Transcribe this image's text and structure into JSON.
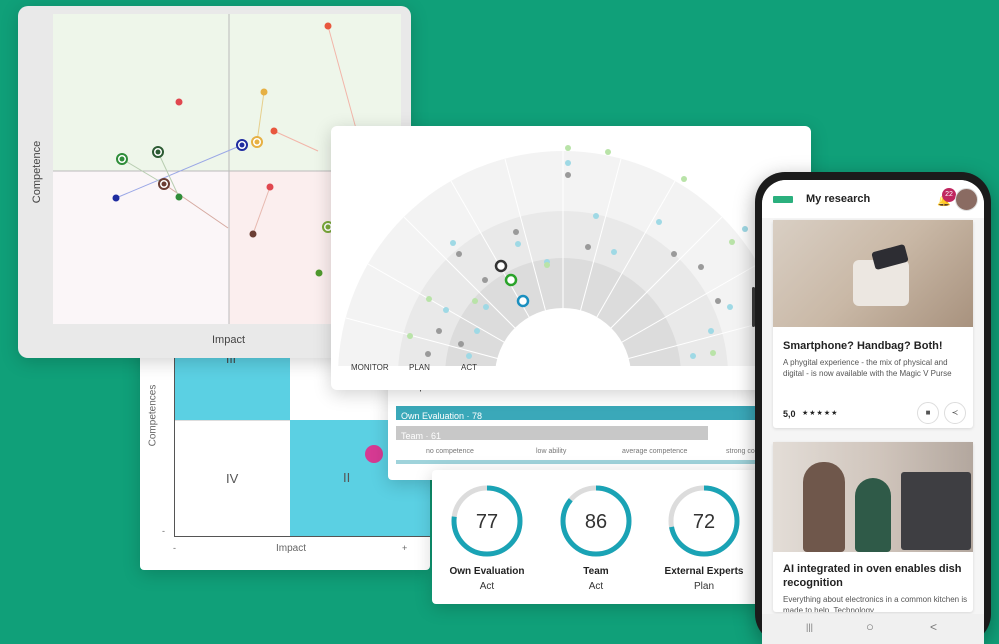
{
  "colors": {
    "background": "#10a079",
    "teal": "#1aa3b5",
    "quadrant_blue": "#5bd0e3",
    "magenta": "#d63a93",
    "gauge_track": "#dcdcdc",
    "own_eval_bar": "#3aa8b9",
    "team_bar": "#c8c8c8"
  },
  "scatter_card": {
    "y_axis_label": "Competence",
    "x_axis_label": "Impact"
  },
  "matrix_card": {
    "y_axis_label": "Competences",
    "x_axis_label": "Impact",
    "quadrants": {
      "top_left": "III",
      "bottom_left": "IV",
      "bottom_right": "II"
    },
    "x_min": "-",
    "x_max": "+",
    "y_min": "-"
  },
  "radar_card": {
    "rings": [
      "MONITOR",
      "PLAN",
      "ACT"
    ]
  },
  "bars_card": {
    "title": "Competences",
    "own_eval_label": "Own Evaluation · 78",
    "team_label": "Team · 61",
    "own_eval_value": 78,
    "team_value": 61,
    "scale": [
      "no competence",
      "low ability",
      "average competence",
      "strong co"
    ]
  },
  "gauges": [
    {
      "value": 77,
      "label": "Own Evaluation",
      "sub": "Act",
      "fraction": 0.77
    },
    {
      "value": 86,
      "label": "Team",
      "sub": "Act",
      "fraction": 0.86
    },
    {
      "value": 72,
      "label": "External Experts",
      "sub": "Plan",
      "fraction": 0.72
    }
  ],
  "phone": {
    "header_title": "My research",
    "notification_count": "22",
    "article1": {
      "title": "Smartphone? Handbag? Both!",
      "body": "A phygital experience - the mix of physical and digital - is now available with the Magic V Purse",
      "rating": "5,0",
      "stars": "★★★★★"
    },
    "article2": {
      "title": "AI integrated in oven enables dish recognition",
      "body": "Everything about electronics in a common kitchen is made to help. Technology"
    },
    "nav": {
      "recent": "|||",
      "home": "○",
      "back": "<"
    }
  }
}
